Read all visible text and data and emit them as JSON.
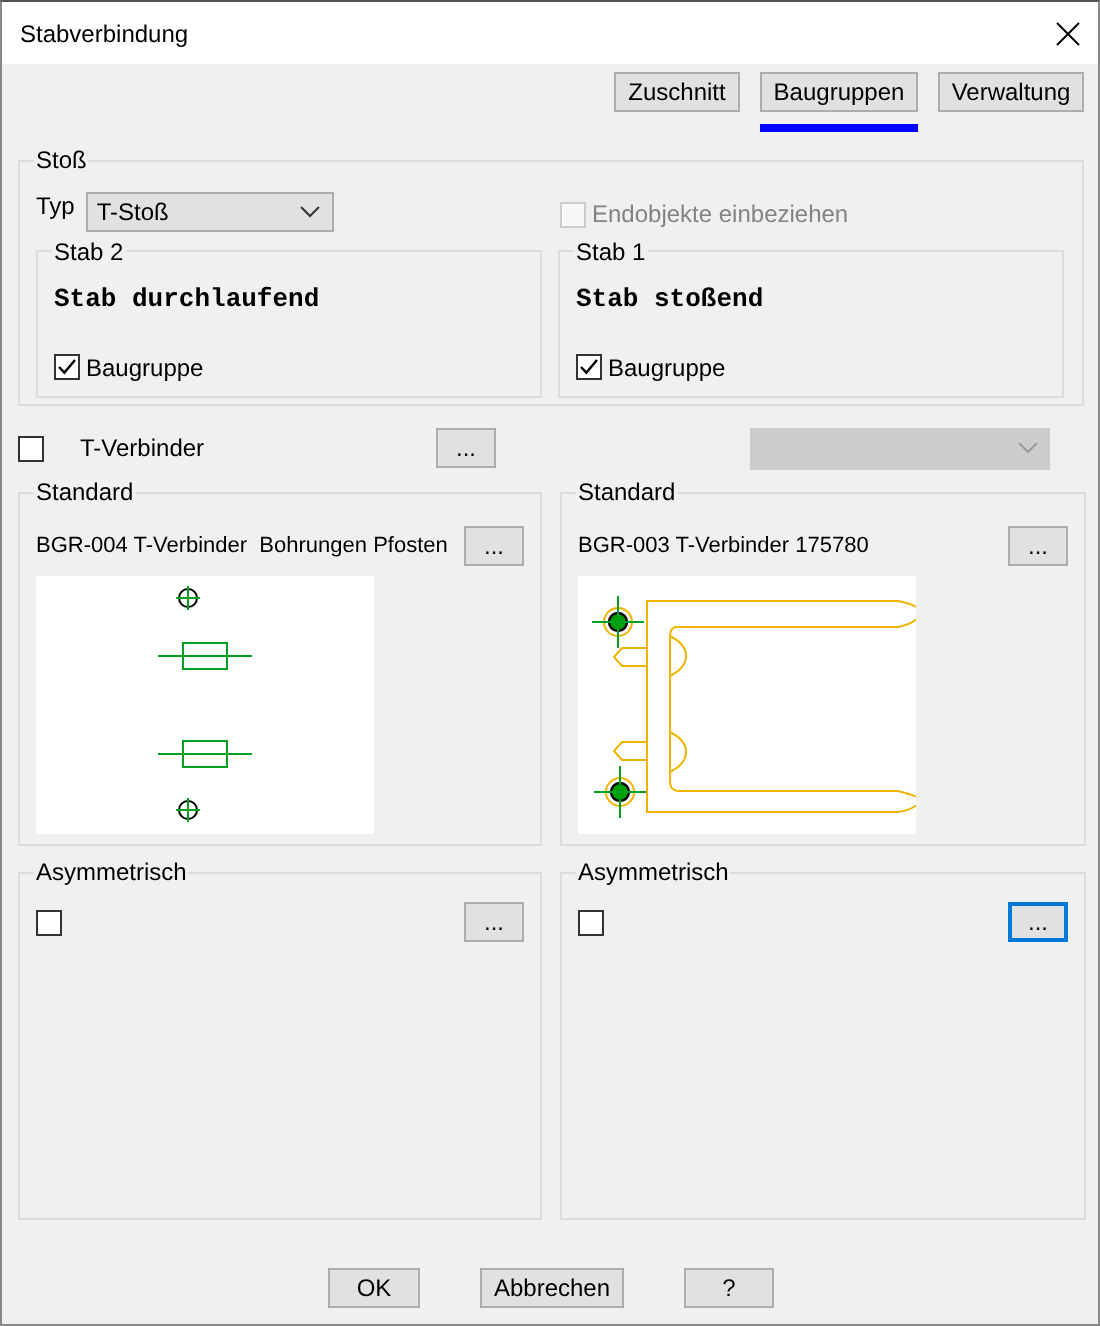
{
  "window": {
    "title": "Stabverbindung"
  },
  "tabs": [
    {
      "label": "Zuschnitt",
      "selected": false
    },
    {
      "label": "Baugruppen",
      "selected": true
    },
    {
      "label": "Verwaltung",
      "selected": false
    }
  ],
  "stoss": {
    "title": "Stoß",
    "typ_label": "Typ",
    "typ_value": "T-Stoß",
    "endobjekte": {
      "label": "Endobjekte einbeziehen",
      "checked": false,
      "disabled": true
    },
    "bars": [
      {
        "title": "Stab 2",
        "text": "Stab durchlaufend",
        "checkbox": {
          "label": "Baugruppe",
          "checked": true
        }
      },
      {
        "title": "Stab 1",
        "text": "Stab stoßend",
        "checkbox": {
          "label": "Baugruppe",
          "checked": true
        }
      }
    ]
  },
  "t_verbinder": {
    "label": "T-Verbinder",
    "checked": false,
    "browse": "...",
    "combo": {
      "disabled": true
    }
  },
  "standard": [
    {
      "title": "Standard",
      "name": "BGR-004 T-Verbinder  Bohrungen Pfosten",
      "browse": "...",
      "kind": "holes"
    },
    {
      "title": "Standard",
      "name": "BGR-003 T-Verbinder 175780",
      "browse": "...",
      "kind": "connector"
    }
  ],
  "asymmetrisch": [
    {
      "title": "Asymmetrisch",
      "checked": false,
      "browse": "...",
      "focused": false
    },
    {
      "title": "Asymmetrisch",
      "checked": false,
      "browse": "...",
      "focused": true
    }
  ],
  "buttons": [
    "OK",
    "Abbrechen",
    "?"
  ]
}
